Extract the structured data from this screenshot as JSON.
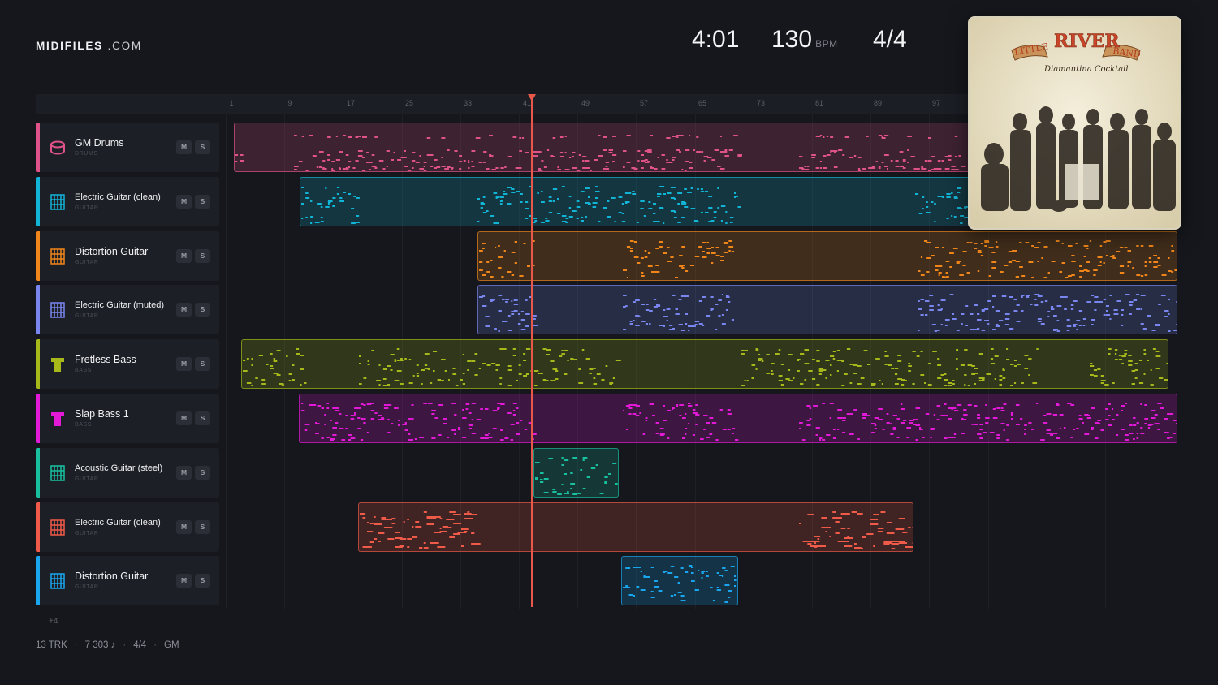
{
  "brand": {
    "name": "MIDIFILES",
    "domain": ".COM"
  },
  "stats": {
    "duration": "4:01",
    "tempo": "130",
    "tempo_unit": "BPM",
    "time_signature": "4/4"
  },
  "album": {
    "art_text_top": "LITTLE",
    "art_text_main": "RIVER",
    "art_text_side": "BAND",
    "art_subtitle": "Diamantina Cocktail"
  },
  "ruler": {
    "ticks": [
      "1",
      "9",
      "17",
      "25",
      "33",
      "41",
      "49",
      "57",
      "65",
      "73",
      "81",
      "89",
      "97"
    ]
  },
  "tracks": [
    {
      "name": "GM Drums",
      "category": "DRUMS",
      "color": "#e0528a",
      "icon": "drum-icon",
      "m": "M",
      "s": "S"
    },
    {
      "name": "Electric Guitar (clean)",
      "category": "GUITAR",
      "color": "#12b4d6",
      "icon": "guitar-icon",
      "m": "M",
      "s": "S"
    },
    {
      "name": "Distortion Guitar",
      "category": "GUITAR",
      "color": "#f0861a",
      "icon": "guitar-icon",
      "m": "M",
      "s": "S"
    },
    {
      "name": "Electric Guitar (muted)",
      "category": "GUITAR",
      "color": "#7a86f0",
      "icon": "guitar-icon",
      "m": "M",
      "s": "S"
    },
    {
      "name": "Fretless Bass",
      "category": "BASS",
      "color": "#a6b81a",
      "icon": "bass-icon",
      "m": "M",
      "s": "S"
    },
    {
      "name": "Slap Bass 1",
      "category": "BASS",
      "color": "#e21ad8",
      "icon": "bass-icon",
      "m": "M",
      "s": "S"
    },
    {
      "name": "Acoustic Guitar (steel)",
      "category": "GUITAR",
      "color": "#18c0a0",
      "icon": "guitar-icon",
      "m": "M",
      "s": "S"
    },
    {
      "name": "Electric Guitar (clean)",
      "category": "GUITAR",
      "color": "#f05a48",
      "icon": "guitar-icon",
      "m": "M",
      "s": "S"
    },
    {
      "name": "Distortion Guitar",
      "category": "GUITAR",
      "color": "#1aa6ee",
      "icon": "guitar-icon",
      "m": "M",
      "s": "S"
    }
  ],
  "more_tracks": "+4",
  "footer": {
    "tracks": "13 TRK",
    "notes": "7 303 ♪",
    "signature": "4/4",
    "standard": "GM"
  }
}
